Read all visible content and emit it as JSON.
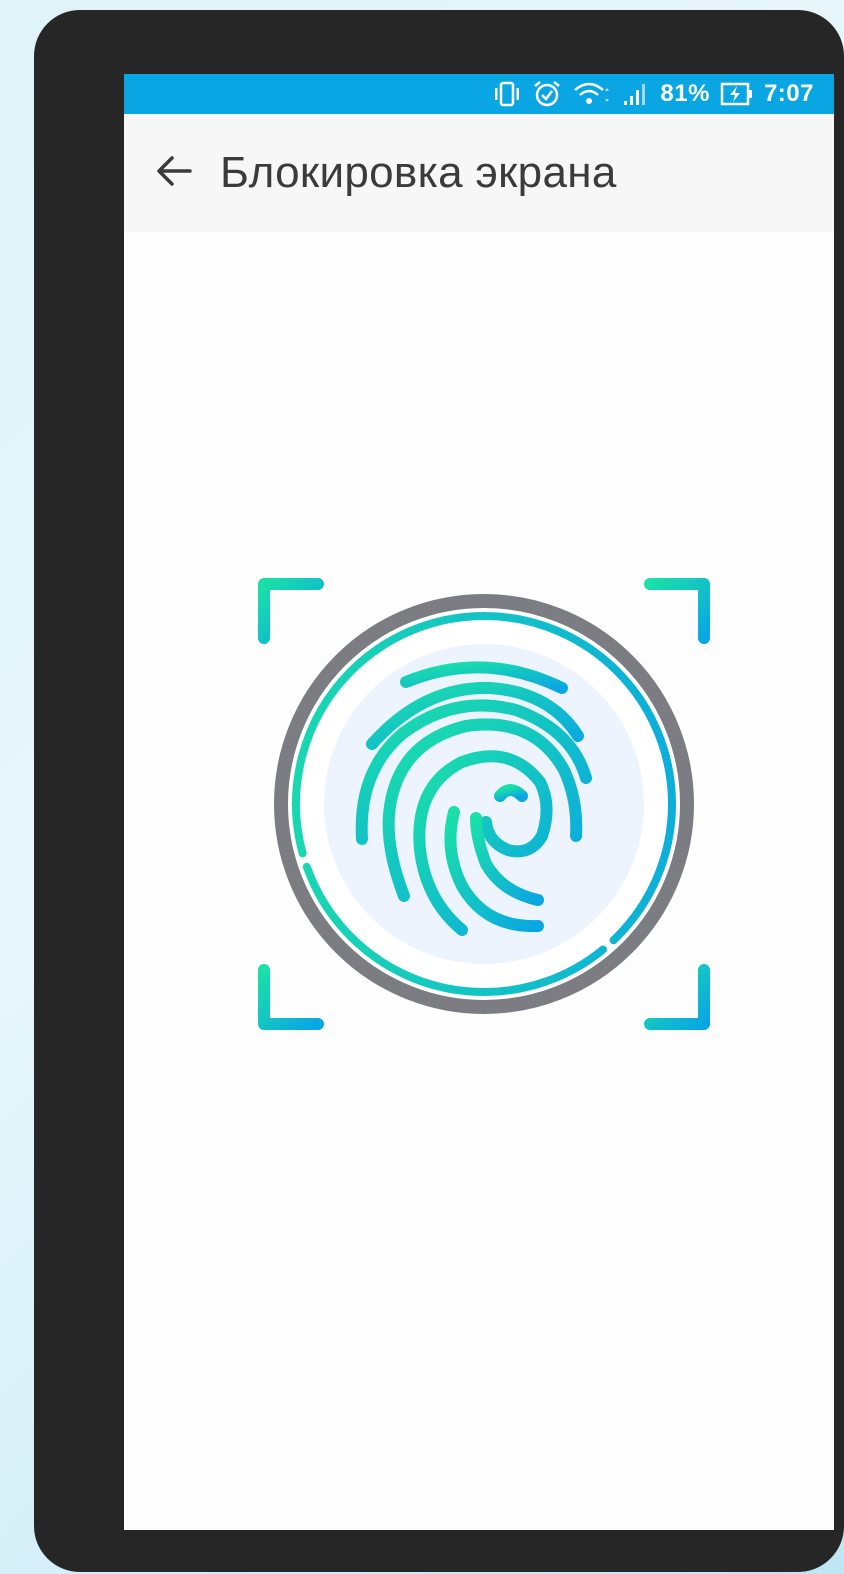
{
  "statusbar": {
    "battery_percent": "81%",
    "time": "7:07",
    "icons": [
      "vibrate-icon",
      "alarm-icon",
      "wifi-icon",
      "signal-icon",
      "battery-charging-icon"
    ],
    "color": "#0aa6e3"
  },
  "appbar": {
    "back_icon": "arrow-left-icon",
    "title": "Блокировка экрана"
  },
  "fingerprint": {
    "icon": "fingerprint-icon",
    "gradient_start": "#1be0a8",
    "gradient_end": "#0aa6e3",
    "ring_color": "#7b7d82",
    "inner_fill": "#edf4fd"
  }
}
